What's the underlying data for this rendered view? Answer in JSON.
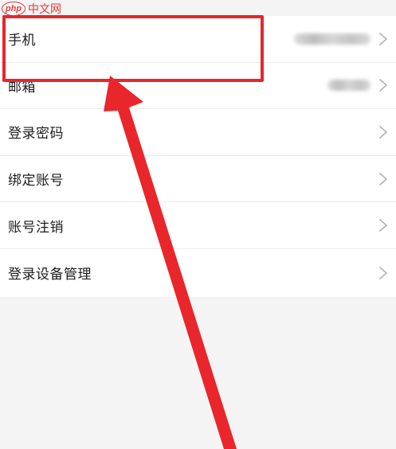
{
  "watermark": {
    "logo": "php",
    "text": "中文网"
  },
  "settings": {
    "items": [
      {
        "label": "手机",
        "has_value": true
      },
      {
        "label": "邮箱",
        "has_value": true
      },
      {
        "label": "登录密码"
      },
      {
        "label": "绑定账号"
      },
      {
        "label": "账号注销"
      },
      {
        "label": "登录设备管理"
      }
    ]
  },
  "icons": {
    "chevron": "chevron-right-icon"
  },
  "colors": {
    "annotation_red": "#e8262b",
    "background": "#f4f4f4",
    "list_background": "#ffffff",
    "label_text": "#1c1c1c",
    "chevron": "#b5b5b5"
  }
}
